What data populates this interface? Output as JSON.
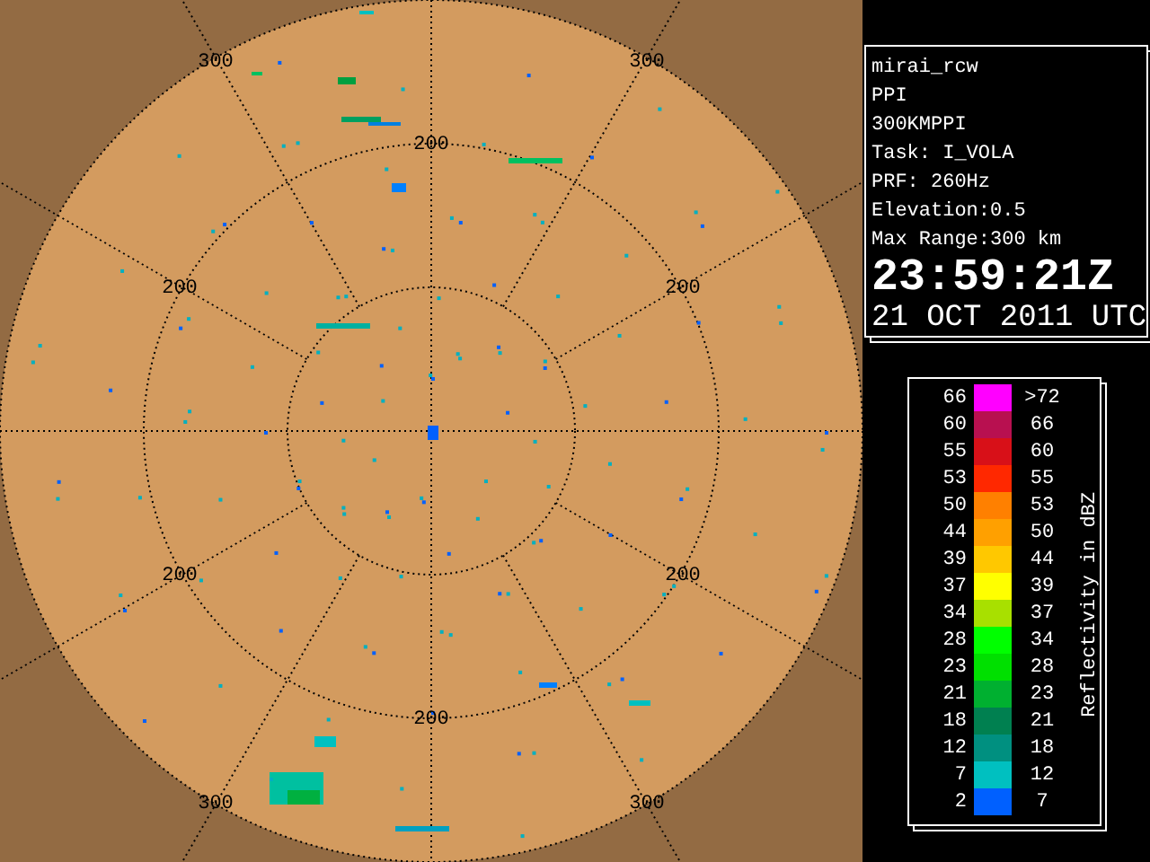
{
  "radar": {
    "range_labels": [
      {
        "text": "300"
      },
      {
        "text": "300"
      },
      {
        "text": "200"
      },
      {
        "text": "200"
      },
      {
        "text": "200"
      },
      {
        "text": "200"
      },
      {
        "text": "200"
      },
      {
        "text": "200"
      },
      {
        "text": "300"
      },
      {
        "text": "300"
      }
    ]
  },
  "info": {
    "lines": [
      "mirai_rcw",
      "PPI",
      "300KMPPI",
      "Task: I_VOLA",
      "PRF: 260Hz",
      "Elevation:0.5",
      "Max Range:300 km"
    ],
    "time": "23:59:21Z",
    "date": "21 OCT 2011 UTC"
  },
  "legend": {
    "title": "Reflectivity in dBZ",
    "rows": [
      {
        "low": "66",
        "high": ">72",
        "color": "#ff00ff"
      },
      {
        "low": "60",
        "high": "66",
        "color": "#b81050"
      },
      {
        "low": "55",
        "high": "60",
        "color": "#d81018"
      },
      {
        "low": "53",
        "high": "55",
        "color": "#ff2800"
      },
      {
        "low": "50",
        "high": "53",
        "color": "#ff8000"
      },
      {
        "low": "44",
        "high": "50",
        "color": "#ffa000"
      },
      {
        "low": "39",
        "high": "44",
        "color": "#ffc800"
      },
      {
        "low": "37",
        "high": "39",
        "color": "#ffff00"
      },
      {
        "low": "34",
        "high": "37",
        "color": "#a8e000"
      },
      {
        "low": "28",
        "high": "34",
        "color": "#00ff00"
      },
      {
        "low": "23",
        "high": "28",
        "color": "#00e000"
      },
      {
        "low": "21",
        "high": "23",
        "color": "#00b030"
      },
      {
        "low": "18",
        "high": "21",
        "color": "#008050"
      },
      {
        "low": "12",
        "high": "18",
        "color": "#009080"
      },
      {
        "low": "7",
        "high": "12",
        "color": "#00c0c0"
      },
      {
        "low": "2",
        "high": "7",
        "color": "#0060ff"
      }
    ]
  }
}
